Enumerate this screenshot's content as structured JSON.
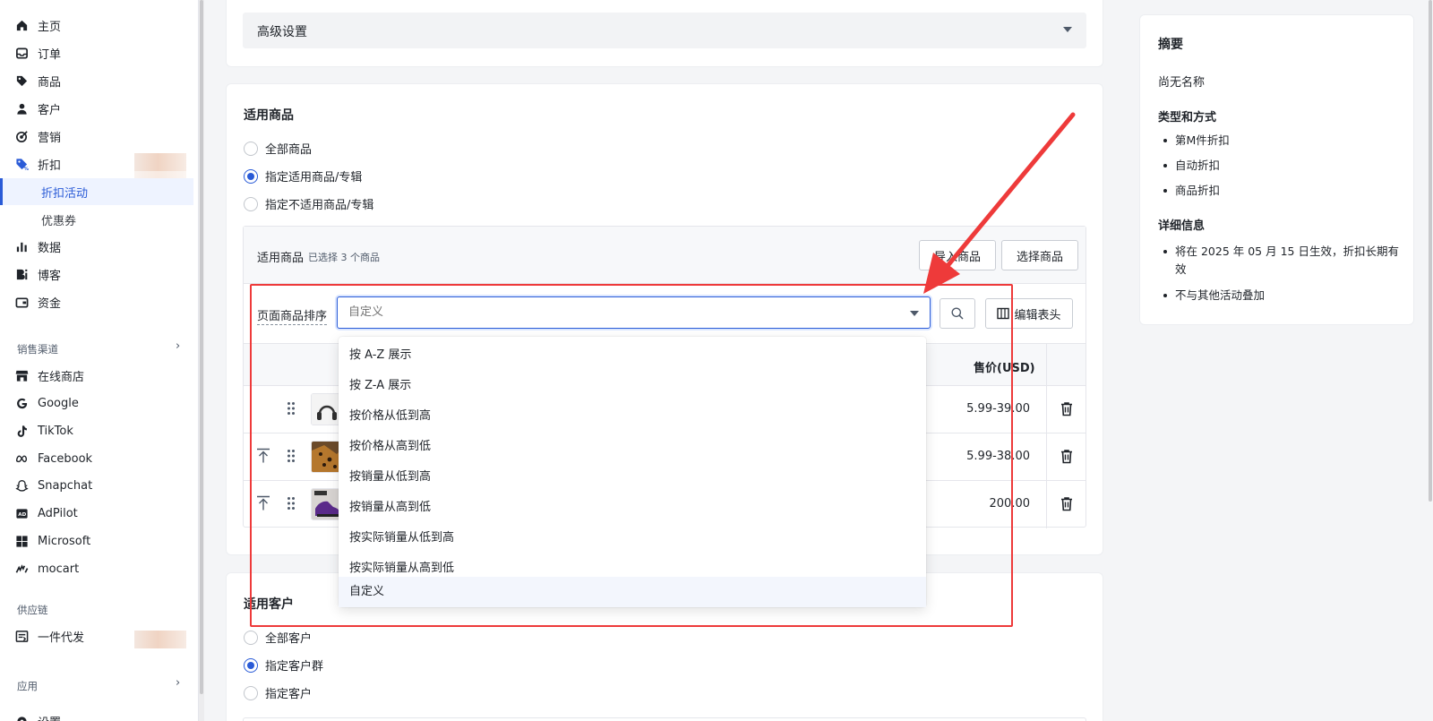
{
  "sidebar": {
    "items": [
      {
        "label": "主页",
        "icon": "home-icon"
      },
      {
        "label": "订单",
        "icon": "inbox-icon"
      },
      {
        "label": "商品",
        "icon": "tag-icon"
      },
      {
        "label": "客户",
        "icon": "person-icon"
      },
      {
        "label": "营销",
        "icon": "target-icon"
      },
      {
        "label": "折扣",
        "icon": "discount-tag-icon"
      }
    ],
    "sub_items": [
      {
        "label": "折扣活动",
        "active": true
      },
      {
        "label": "优惠券",
        "active": false
      }
    ],
    "items2": [
      {
        "label": "数据",
        "icon": "bar-chart-icon"
      },
      {
        "label": "博客",
        "icon": "blog-icon"
      },
      {
        "label": "资金",
        "icon": "wallet-icon"
      }
    ],
    "sales_channel_title": "销售渠道",
    "channels": [
      {
        "label": "在线商店",
        "icon": "store-icon"
      },
      {
        "label": "Google",
        "icon": "google-icon"
      },
      {
        "label": "TikTok",
        "icon": "tiktok-icon"
      },
      {
        "label": "Facebook",
        "icon": "meta-icon"
      },
      {
        "label": "Snapchat",
        "icon": "snapchat-icon"
      },
      {
        "label": "AdPilot",
        "icon": "ad-icon"
      },
      {
        "label": "Microsoft",
        "icon": "microsoft-icon"
      },
      {
        "label": "mocart",
        "icon": "mocart-icon"
      }
    ],
    "supply_chain_title": "供应链",
    "supply_items": [
      {
        "label": "一件代发",
        "icon": "dropship-icon"
      }
    ],
    "apps_title": "应用",
    "settings_label": "设置"
  },
  "advanced": {
    "label": "高级设置"
  },
  "applicable_goods": {
    "title": "适用商品",
    "options": [
      {
        "label": "全部商品",
        "checked": false
      },
      {
        "label": "指定适用商品/专辑",
        "checked": true
      },
      {
        "label": "指定不适用商品/专辑",
        "checked": false
      }
    ],
    "box_title": "适用商品",
    "selected_count": "已选择 3 个商品",
    "import_btn": "导入商品",
    "choose_btn": "选择商品",
    "sort_label": "页面商品排序",
    "sort_placeholder": "自定义",
    "edit_header_btn": "编辑表头",
    "price_header": "售价(USD)",
    "rows": [
      {
        "price": "5.99-39.00",
        "pinned": false
      },
      {
        "price": "5.99-38.00",
        "pinned": true
      },
      {
        "price": "200.00",
        "pinned": true
      }
    ]
  },
  "sort_dropdown": {
    "options": [
      {
        "label": "按 A-Z 展示",
        "selected": false
      },
      {
        "label": "按 Z-A 展示",
        "selected": false
      },
      {
        "label": "按价格从低到高",
        "selected": false
      },
      {
        "label": "按价格从高到低",
        "selected": false
      },
      {
        "label": "按销量从低到高",
        "selected": false
      },
      {
        "label": "按销量从高到低",
        "selected": false
      },
      {
        "label": "按实际销量从低到高",
        "selected": false
      },
      {
        "label": "按实际销量从高到低",
        "selected": false
      },
      {
        "label": "自定义",
        "selected": true
      }
    ]
  },
  "applicable_customers": {
    "title": "适用客户",
    "options": [
      {
        "label": "全部客户",
        "checked": false
      },
      {
        "label": "指定客户群",
        "checked": true
      },
      {
        "label": "指定客户",
        "checked": false
      }
    ]
  },
  "summary": {
    "title": "摘要",
    "name": "尚无名称",
    "type_title": "类型和方式",
    "type_items": [
      "第M件折扣",
      "自动折扣",
      "商品折扣"
    ],
    "detail_title": "详细信息",
    "detail_items": [
      "将在 2025 年 05 月 15 日生效，折扣长期有效",
      "不与其他活动叠加"
    ]
  },
  "colors": {
    "accent": "#2a5bd7",
    "annotation": "#ee3a3a"
  }
}
